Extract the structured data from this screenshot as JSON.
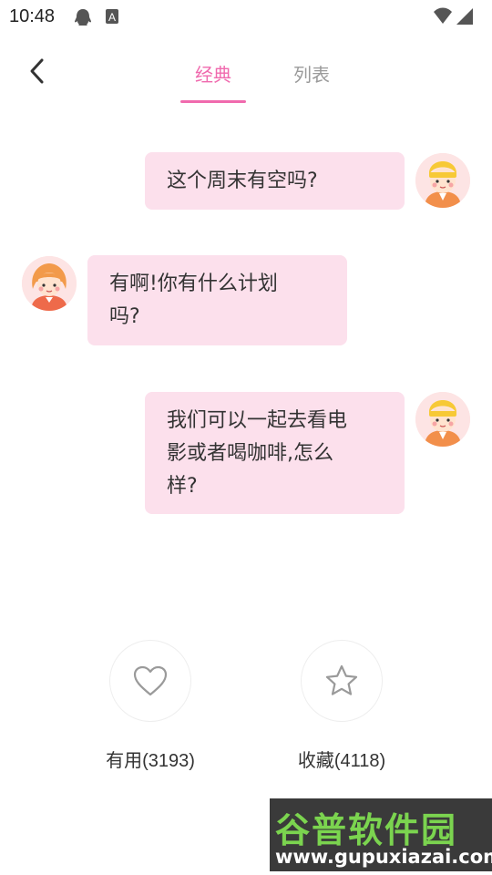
{
  "status_bar": {
    "time": "10:48",
    "icons": [
      "qq-icon",
      "a-notification-icon",
      "wifi-icon",
      "signal-icon"
    ]
  },
  "header": {
    "tabs": [
      {
        "label": "经典",
        "active": true
      },
      {
        "label": "列表",
        "active": false
      }
    ],
    "accent_color": "#f06aae"
  },
  "chat": {
    "messages": [
      {
        "side": "right",
        "lines": [
          "这个周末有空吗?"
        ],
        "avatar": "boy-yellow-cap-avatar"
      },
      {
        "side": "left",
        "lines": [
          "有啊!你有什么计划",
          "吗?"
        ],
        "avatar": "girl-orange-hair-avatar"
      },
      {
        "side": "right",
        "lines": [
          "我们可以一起去看电",
          "影或者喝咖啡,怎么",
          "样?"
        ],
        "avatar": "boy-yellow-cap-avatar"
      }
    ],
    "bubble_color": "#fce0ec"
  },
  "actions": {
    "useful_label": "有用(3193)",
    "favorite_label": "收藏(4118)"
  },
  "watermark": {
    "title": "谷普软件园",
    "url": "www.gupuxiazai.com"
  }
}
